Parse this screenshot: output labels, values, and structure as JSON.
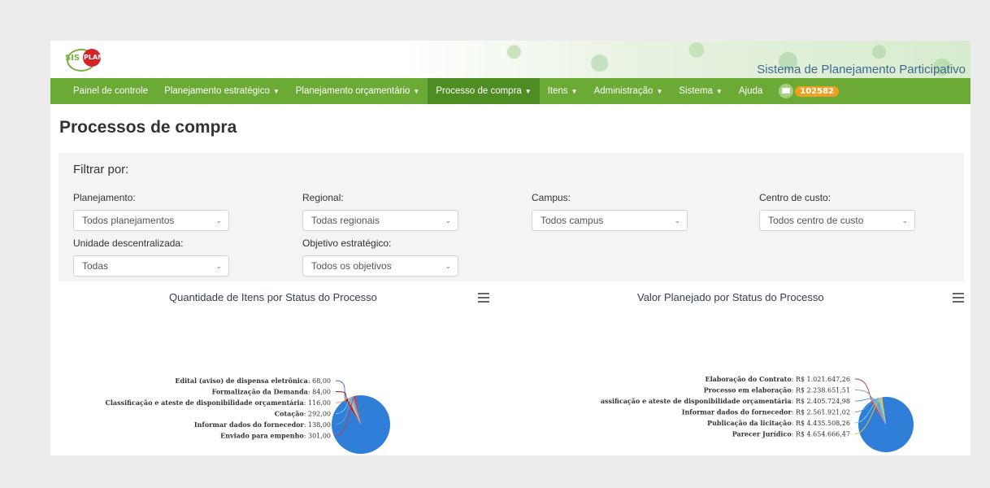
{
  "app": {
    "logo_text_sis": "SIS",
    "logo_text_plan": "PLAN",
    "site_title": "Sistema de Planejamento Participativo"
  },
  "nav": {
    "items": [
      {
        "label": "Painel de controle",
        "caret": false,
        "active": false
      },
      {
        "label": "Planejamento estratégico",
        "caret": true,
        "active": false
      },
      {
        "label": "Planejamento orçamentário",
        "caret": true,
        "active": false
      },
      {
        "label": "Processo de compra",
        "caret": true,
        "active": true
      },
      {
        "label": "Itens",
        "caret": true,
        "active": false
      },
      {
        "label": "Administração",
        "caret": true,
        "active": false
      },
      {
        "label": "Sistema",
        "caret": true,
        "active": false
      },
      {
        "label": "Ajuda",
        "caret": false,
        "active": false
      }
    ],
    "mail_count": "102582"
  },
  "page_title": "Processos de compra",
  "filters": {
    "heading": "Filtrar por:",
    "fields": [
      {
        "label": "Planejamento:",
        "value": "Todos planejamentos"
      },
      {
        "label": "Regional:",
        "value": "Todas regionais"
      },
      {
        "label": "Campus:",
        "value": "Todos campus"
      },
      {
        "label": "Centro de custo:",
        "value": "Todos centro de custo"
      },
      {
        "label": "Unidade descentralizada:",
        "value": "Todas"
      },
      {
        "label": "Objetivo estratégico:",
        "value": "Todos os objetivos"
      }
    ]
  },
  "chart_data": [
    {
      "type": "pie",
      "title": "Quantidade de Itens por Status do Processo",
      "slices": [
        {
          "name": "Edital (aviso) de dispensa eletrônica",
          "label": "68,00",
          "value": 68
        },
        {
          "name": "Formalização da Demanda",
          "label": "84,00",
          "value": 84
        },
        {
          "name": "Classificação e ateste de disponibilidade orçamentária",
          "label": "116,00",
          "value": 116
        },
        {
          "name": "Cotação",
          "label": "292,00",
          "value": 292
        },
        {
          "name": "Informar dados do fornecedor",
          "label": "138,00",
          "value": 138
        },
        {
          "name": "Enviado para empenho",
          "label": "301,00",
          "value": 301
        }
      ],
      "colors": [
        "#4472c4",
        "#8a1a1a",
        "#f0a070",
        "#7cc7e8",
        "#5aa0d8",
        "#c04040"
      ],
      "main_color": "#2f7ed8"
    },
    {
      "type": "pie",
      "title": "Valor Planejado por Status do Processo",
      "slices": [
        {
          "name": "Elaboração do Contrato",
          "label": "R$ 1.021.647,26",
          "value": 1021647.26
        },
        {
          "name": "Processo em elaboração",
          "label": "R$ 2.238.651,51",
          "value": 2238651.51
        },
        {
          "name": "assificação e ateste de disponibilidade orçamentária",
          "label": "R$ 2.405.724,98",
          "value": 2405724.98
        },
        {
          "name": "Informar dados do fornecedor",
          "label": "R$ 2.561.921,02",
          "value": 2561921.02
        },
        {
          "name": "Publicação da licitação",
          "label": "R$ 4.435.508,26",
          "value": 4435508.26
        },
        {
          "name": "Parecer Jurídico",
          "label": "R$ 4.654.666,47",
          "value": 4654666.47
        }
      ],
      "colors": [
        "#c04040",
        "#999999",
        "#5aa0d8",
        "#5aa0d8",
        "#7cc7e8",
        "#e0c040"
      ],
      "main_color": "#2f7ed8"
    }
  ]
}
